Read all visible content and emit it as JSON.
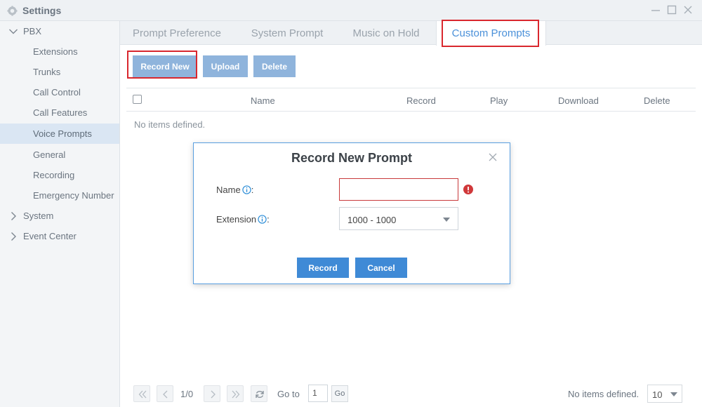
{
  "window": {
    "title": "Settings"
  },
  "sidebar": {
    "items": [
      {
        "label": "PBX"
      },
      {
        "label": "Extensions"
      },
      {
        "label": "Trunks"
      },
      {
        "label": "Call Control"
      },
      {
        "label": "Call Features"
      },
      {
        "label": "Voice Prompts"
      },
      {
        "label": "General"
      },
      {
        "label": "Recording"
      },
      {
        "label": "Emergency Number"
      },
      {
        "label": "System"
      },
      {
        "label": "Event Center"
      }
    ]
  },
  "tabs": [
    {
      "label": "Prompt Preference"
    },
    {
      "label": "System Prompt"
    },
    {
      "label": "Music on Hold"
    },
    {
      "label": "Custom Prompts"
    }
  ],
  "toolbar": {
    "record_new": "Record New",
    "upload": "Upload",
    "delete": "Delete"
  },
  "table": {
    "columns": [
      "Name",
      "Record",
      "Play",
      "Download",
      "Delete"
    ],
    "empty_message": "No items defined."
  },
  "pager": {
    "page_info": "1/0",
    "goto_label": "Go to",
    "page_value": "1",
    "go_label": "Go",
    "status": "No items defined.",
    "page_size": "10"
  },
  "modal": {
    "title": "Record New Prompt",
    "name_label": "Name",
    "name_value": "",
    "extension_label": "Extension",
    "extension_value": "1000 - 1000",
    "record_button": "Record",
    "cancel_button": "Cancel"
  },
  "colors": {
    "accent": "#4a90d9",
    "button_primary": "#3f8ad6",
    "button_disabled": "#8fb4dc",
    "highlight_box": "#d9272e",
    "error": "#c8393a",
    "sidebar_active": "#dae6f3"
  }
}
